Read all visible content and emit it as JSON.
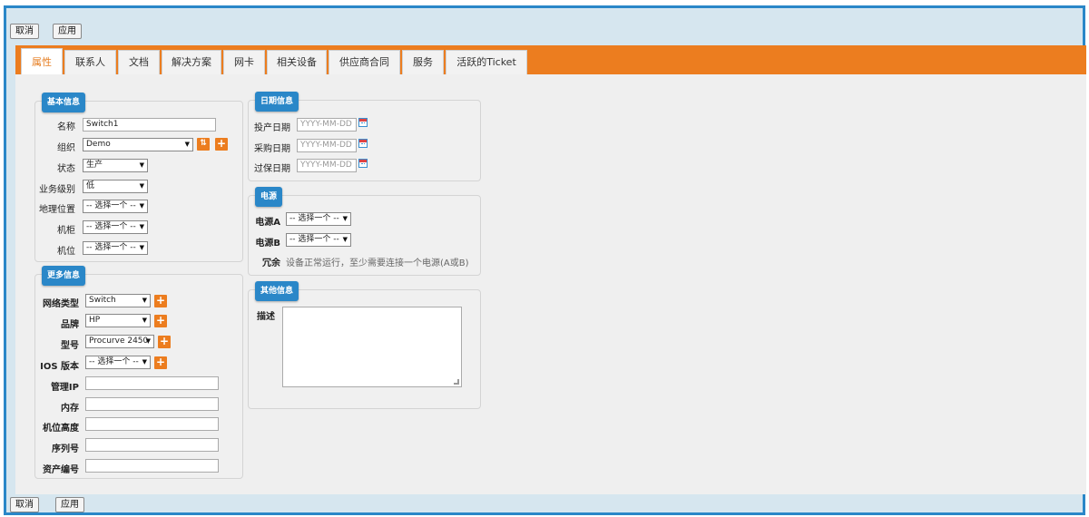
{
  "toolbar": {
    "cancel_label": "取消",
    "apply_label": "应用"
  },
  "tabs": [
    "属性",
    "联系人",
    "文档",
    "解决方案",
    "网卡",
    "相关设备",
    "供应商合同",
    "服务",
    "活跃的Ticket"
  ],
  "basic": {
    "legend": "基本信息",
    "name_label": "名称",
    "name_value": "Switch1",
    "org_label": "组织",
    "org_value": "Demo",
    "status_label": "状态",
    "status_value": "生产",
    "criticality_label": "业务级别",
    "criticality_value": "低",
    "location_label": "地理位置",
    "location_value": "-- 选择一个 --",
    "rack_label": "机柜",
    "rack_value": "-- 选择一个 --",
    "enclosure_label": "机位",
    "enclosure_value": "-- 选择一个 --"
  },
  "more": {
    "legend": "更多信息",
    "nettype_label": "网络类型",
    "nettype_value": "Switch",
    "brand_label": "品牌",
    "brand_value": "HP",
    "model_label": "型号",
    "model_value": "Procurve 2450",
    "ios_label": "IOS 版本",
    "ios_value": "-- 选择一个 --",
    "mgmtip_label": "管理IP",
    "ram_label": "内存",
    "rackunits_label": "机位高度",
    "serial_label": "序列号",
    "asset_label": "资产编号"
  },
  "dates": {
    "legend": "日期信息",
    "production_label": "投产日期",
    "purchase_label": "采购日期",
    "warranty_label": "过保日期",
    "placeholder": "YYYY-MM-DD"
  },
  "power": {
    "legend": "电源",
    "a_label": "电源A",
    "a_value": "-- 选择一个 --",
    "b_label": "电源B",
    "b_value": "-- 选择一个 --",
    "redundancy_label": "冗余",
    "redundancy_text": "设备正常运行，至少需要连接一个电源(A或B)"
  },
  "other": {
    "legend": "其他信息",
    "desc_label": "描述"
  },
  "colors": {
    "accent": "#ec7d1f",
    "frame": "#2a87c8",
    "legend_bg": "#2a87c8"
  }
}
